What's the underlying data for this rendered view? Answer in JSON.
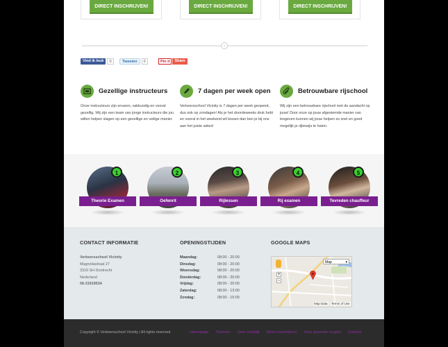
{
  "cta_label": "DIRECT INSCHRIJVEN!",
  "divider_glyph": "‹",
  "social": {
    "facebook_label": "Vind ik leuk",
    "facebook_count": "0",
    "twitter_label": "Tweeten",
    "twitter_count": "0",
    "pinterest_label": "Pin it",
    "share_label": "Share"
  },
  "features": [
    {
      "icon": "certificate-icon",
      "title": "Gezellige instructeurs",
      "text": "Onze instructeurs zijn ervaren, vakkundig en vooral gezellig. Wij zijn een team van jonge instructeurs die jou willen helpen slagen op een gezellige en veilige manier."
    },
    {
      "icon": "pencil-icon",
      "title": "7 dagen per week open",
      "text": "Verkeersschool Vicinity is 7 dagen per week geopend, dus ook op zondagen! Als je het doordeweeks druk hebt en vooral in het weekend wil lessen dan ben je bij ons aan het juiste adres!"
    },
    {
      "icon": "paperclip-icon",
      "title": "Betrouwbare rijschool",
      "text": "Wij zijn een betrouwbare rijschool met de aandacht op jouw! Door onze op jouw afgestemde manier van lesgeven kunnen wij jouw helpen zo snel en goed mogelijk je rijbewijs te halen."
    }
  ],
  "steps": [
    {
      "number": "1",
      "label": "Theorie Examen"
    },
    {
      "number": "2",
      "label": "Oefenrit"
    },
    {
      "number": "3",
      "label": "Rijlessen"
    },
    {
      "number": "4",
      "label": "Rij examen"
    },
    {
      "number": "5",
      "label": "Tevreden chauffeur"
    }
  ],
  "contact": {
    "title": "CONTACT INFORMATIE",
    "name": "Verkeersschool Vicinity",
    "street": "Magnoliastraat 27",
    "city": "3319 SH Dordrecht",
    "country": "Nederland",
    "phone": "06-31919534"
  },
  "hours": {
    "title": "OPENINGSTIJDEN",
    "rows": [
      {
        "day": "Maandag:",
        "time": "08:00 - 20:00"
      },
      {
        "day": "Dinsdag:",
        "time": "08:00 - 20:00"
      },
      {
        "day": "Woensdag:",
        "time": "08:00 - 20:00"
      },
      {
        "day": "Donderdag:",
        "time": "08:00 - 20:00"
      },
      {
        "day": "Vrijdag:",
        "time": "08:00 - 20:00"
      },
      {
        "day": "Zaterdag:",
        "time": "08:00 - 13:00"
      },
      {
        "day": "Zondag:",
        "time": "08:00 - 15:00"
      }
    ]
  },
  "map": {
    "title": "GOOGLE MAPS",
    "type_label": "Map",
    "data_label": "Map Data",
    "terms_label": "Terms of Use",
    "zoom_in": "+",
    "zoom_out": "−"
  },
  "footer": {
    "copyright": "Copyright © Verkeersschool Vicinity | All rights reserved",
    "links": [
      "Homepage",
      "Tarieven",
      "Over ons/pdt",
      "Direct inschrijven!",
      "Voor gezonde vragen",
      "Contact"
    ]
  },
  "colors": {
    "accent_green": "#6aa93f",
    "label_purple": "#7a1f8f",
    "badge_green": "#39d12f",
    "link_purple": "#8e2fa3"
  }
}
